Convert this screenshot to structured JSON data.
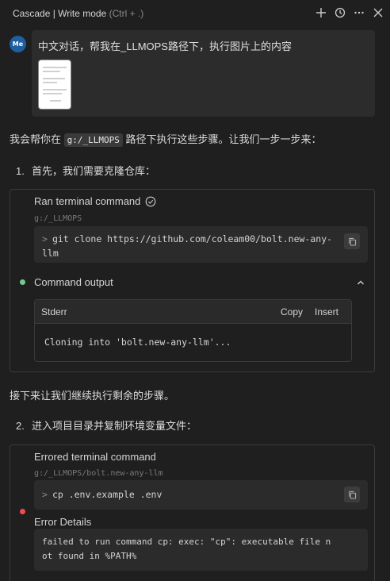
{
  "header": {
    "title": "Cascade | Write mode",
    "shortcut": "(Ctrl + .)",
    "actions": [
      "plus-icon",
      "history-icon",
      "more-icon",
      "close-icon"
    ]
  },
  "user": {
    "avatar": "Me",
    "message": "中文对话，帮我在_LLMOPS路径下，执行图片上的内容"
  },
  "assistant": {
    "intro_before": "我会帮你在 ",
    "intro_path": "g:/_LLMOPS",
    "intro_after": " 路径下执行这些步骤。让我们一步一步来：",
    "step1_num": "1.",
    "step1": "首先，我们需要克隆仓库：",
    "card1": {
      "title": "Ran terminal command",
      "cwd": "g:/_LLMOPS",
      "prompt": ">",
      "command_line1": "git clone https://github.com/coleam00/bolt.new-any-",
      "command_line2": "llm",
      "output_label": "Command output",
      "stderr_title": "Stderr",
      "copy_label": "Copy",
      "insert_label": "Insert",
      "stderr_text": "Cloning into 'bolt.new-any-llm'..."
    },
    "continue_text": "接下来让我们继续执行剩余的步骤。",
    "step2_num": "2.",
    "step2": "进入项目目录并复制环境变量文件：",
    "card2": {
      "title": "Errored terminal command",
      "cwd": "g:/_LLMOPS/bolt.new-any-llm",
      "prompt": ">",
      "command": "cp .env.example .env",
      "error_label": "Error Details",
      "error_line1": "failed to run command cp: exec: \"cp\": executable file n",
      "error_line2": "ot found in %PATH%"
    }
  },
  "colors": {
    "success_dot": "#73c991",
    "error_dot": "#f14c4c",
    "avatar_bg": "#1e5fa0"
  }
}
